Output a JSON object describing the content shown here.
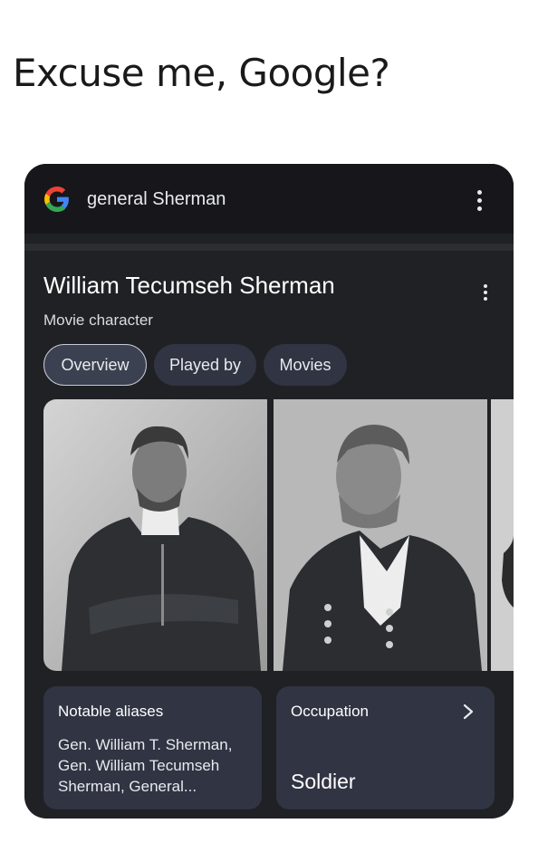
{
  "caption": "Excuse me, Google?",
  "search": {
    "query": "general Sherman"
  },
  "entity": {
    "title": "William Tecumseh Sherman",
    "subtitle": "Movie character"
  },
  "tabs": [
    {
      "label": "Overview",
      "active": true
    },
    {
      "label": "Played by",
      "active": false
    },
    {
      "label": "Movies",
      "active": false
    }
  ],
  "info_cards": {
    "aliases": {
      "label": "Notable aliases",
      "value": "Gen. William T. Sherman, Gen. William Tecumseh Sherman, General..."
    },
    "occupation": {
      "label": "Occupation",
      "value": "Soldier"
    }
  },
  "icons": [
    "google-logo-icon",
    "more-vert-icon",
    "chevron-right-icon"
  ],
  "colors": {
    "card_bg": "#202124",
    "searchbar_bg": "#17171b",
    "chip_bg": "#303443",
    "text_primary": "#ffffff"
  }
}
